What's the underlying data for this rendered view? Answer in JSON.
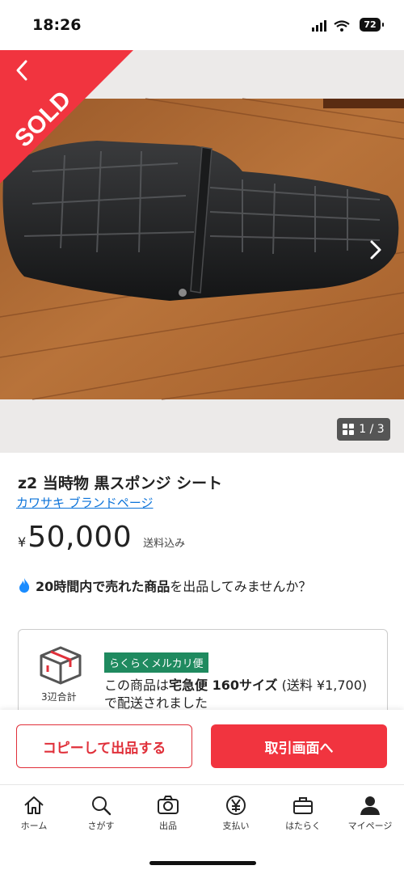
{
  "status_bar": {
    "time": "18:26",
    "battery": "72"
  },
  "listing": {
    "sold_label": "SOLD",
    "image_counter": "1 / 3",
    "title": "z2 当時物 黒スポンジ シート",
    "brand_link": "カワサキ ブランドページ",
    "currency": "¥",
    "price": "50,000",
    "shipping_note": "送料込み",
    "promo_bold": "20時間内で売れた商品",
    "promo_rest": "を出品してみませんか？"
  },
  "shipping_card": {
    "box_label": "3辺合計",
    "tag": "らくらくメルカリ便",
    "text_pre": "この商品は",
    "text_bold1": "宅急便 160サイズ",
    "text_mid": " (送料 ¥1,700) で配送されました"
  },
  "actions": {
    "copy_label": "コピーして出品する",
    "trade_label": "取引画面へ"
  },
  "tabbar": {
    "items": [
      {
        "label": "ホーム",
        "icon": "home-icon"
      },
      {
        "label": "さがす",
        "icon": "search-icon"
      },
      {
        "label": "出品",
        "icon": "camera-icon"
      },
      {
        "label": "支払い",
        "icon": "yen-icon"
      },
      {
        "label": "はたらく",
        "icon": "briefcase-icon"
      },
      {
        "label": "マイページ",
        "icon": "person-icon"
      }
    ]
  },
  "colors": {
    "accent": "#f1343f",
    "link": "#0a72d9",
    "tag_green": "#1f8a5f"
  }
}
